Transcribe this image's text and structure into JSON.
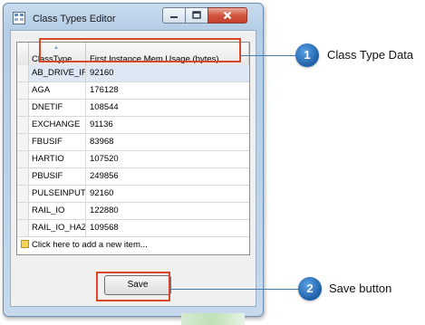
{
  "window": {
    "title": "Class Types Editor",
    "controls": [
      "minimize",
      "maximize",
      "close"
    ]
  },
  "grid": {
    "columns": [
      "ClassType",
      "First Instance Mem Usage (bytes)"
    ],
    "rows": [
      {
        "type": "AB_DRIVE_IF",
        "mem": "92160"
      },
      {
        "type": "AGA",
        "mem": "176128"
      },
      {
        "type": "DNETIF",
        "mem": "108544"
      },
      {
        "type": "EXCHANGE",
        "mem": "91136"
      },
      {
        "type": "FBUSIF",
        "mem": "83968"
      },
      {
        "type": "HARTIO",
        "mem": "107520"
      },
      {
        "type": "PBUSIF",
        "mem": "249856"
      },
      {
        "type": "PULSEINPUT",
        "mem": "92160"
      },
      {
        "type": "RAIL_IO",
        "mem": "122880"
      },
      {
        "type": "RAIL_IO_HAZ",
        "mem": "109568"
      }
    ],
    "new_item_label": "Click here to add a new item..."
  },
  "save_label": "Save",
  "callouts": [
    {
      "number": "1",
      "label": "Class Type Data"
    },
    {
      "number": "2",
      "label": "Save button"
    }
  ],
  "colors": {
    "highlight": "#d9472b",
    "badge": "#2a6db5"
  }
}
